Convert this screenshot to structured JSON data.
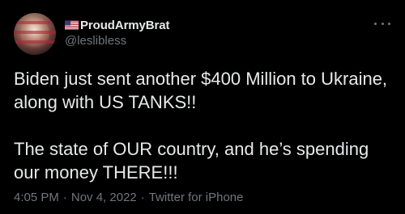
{
  "author": {
    "display_name": "ProudArmyBrat",
    "handle": "@leslibless",
    "name_prefix_icon": "us-flag-icon"
  },
  "tweet": {
    "paragraphs": [
      "Biden just sent another $400 Million to Ukraine, along with US TANKS!!",
      "The state of OUR country, and he’s spending our money THERE!!!"
    ],
    "time": "4:05 PM",
    "separator": "·",
    "date": "Nov 4, 2022",
    "source": "Twitter for iPhone"
  },
  "menu": {
    "icon": "more-options-icon"
  },
  "colors": {
    "background": "#000000",
    "primary_text": "#e7e9ea",
    "secondary_text": "#71767b"
  }
}
